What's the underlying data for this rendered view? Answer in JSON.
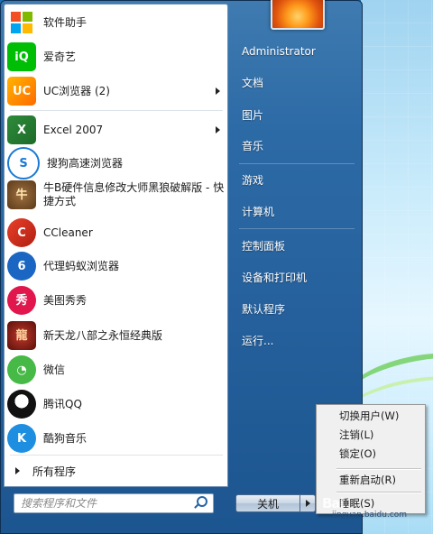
{
  "programs": [
    {
      "label": "软件助手",
      "icon": "windows-logo-icon",
      "has_arrow": false
    },
    {
      "label": "爱奇艺",
      "icon": "iqiyi-icon",
      "has_arrow": false
    },
    {
      "label": "UC浏览器 (2)",
      "icon": "uc-browser-icon",
      "has_arrow": true
    },
    {
      "label": "Excel 2007",
      "icon": "excel-icon",
      "has_arrow": true
    },
    {
      "label": "搜狗高速浏览器",
      "icon": "sogou-browser-icon",
      "has_arrow": false
    },
    {
      "label": "牛B硬件信息修改大师黑狼破解版 - 快捷方式",
      "icon": "cow-icon",
      "has_arrow": false
    },
    {
      "label": "CCleaner",
      "icon": "ccleaner-icon",
      "has_arrow": false
    },
    {
      "label": "代理蚂蚁浏览器",
      "icon": "ant-browser-icon",
      "has_arrow": false
    },
    {
      "label": "美图秀秀",
      "icon": "meitu-icon",
      "has_arrow": false
    },
    {
      "label": "新天龙八部之永恒经典版",
      "icon": "tlbb-game-icon",
      "has_arrow": false
    },
    {
      "label": "微信",
      "icon": "wechat-icon",
      "has_arrow": false
    },
    {
      "label": "腾讯QQ",
      "icon": "qq-penguin-icon",
      "has_arrow": false
    },
    {
      "label": "酷狗音乐",
      "icon": "kugou-icon",
      "has_arrow": false
    }
  ],
  "all_programs": "所有程序",
  "search": {
    "placeholder": "搜索程序和文件"
  },
  "right_pane": {
    "username": "Administrator",
    "items": [
      "文档",
      "图片",
      "音乐",
      "游戏",
      "计算机",
      "控制面板",
      "设备和打印机",
      "默认程序",
      "运行..."
    ]
  },
  "shutdown": {
    "label": "关机"
  },
  "power_menu": {
    "items": [
      "切换用户(W)",
      "注销(L)",
      "锁定(O)",
      "重新启动(R)",
      "睡眠(S)"
    ]
  },
  "watermark": {
    "logo": "Bai",
    "url": "jingyan.baidu.com"
  },
  "colors": {
    "start_menu": "#2c6aa6",
    "desktop": "#c9ebfb",
    "menu_bg": "#f0f0f0"
  }
}
